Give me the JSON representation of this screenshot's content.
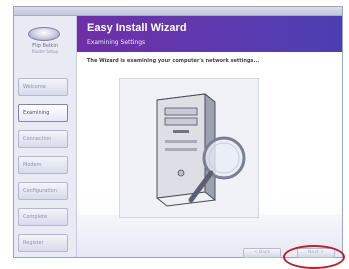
{
  "window": {
    "title": ""
  },
  "sidebar": {
    "brand_name": "Flip Belkin",
    "brand_sub": "Router Setup",
    "steps": [
      {
        "label": "Welcome"
      },
      {
        "label": "Examining"
      },
      {
        "label": "Connection"
      },
      {
        "label": "Modem"
      },
      {
        "label": "Configuration"
      },
      {
        "label": "Complete"
      },
      {
        "label": "Register"
      }
    ],
    "active_step_index": 1
  },
  "header": {
    "wizard_title": "Easy Install Wizard",
    "section_title": "Examining Settings"
  },
  "main": {
    "instruction": "The Wizard is examining your computer's network settings..."
  },
  "buttons": {
    "back_label": "< Back",
    "next_label": "Next >"
  },
  "colors": {
    "header_gradient_start": "#6f2fa6",
    "header_gradient_end": "#4a3fb1",
    "highlight_ring": "#b0232f"
  }
}
